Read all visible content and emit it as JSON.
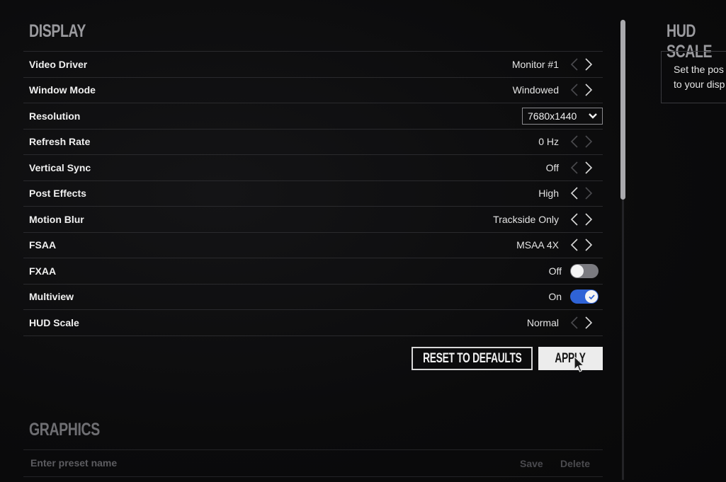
{
  "sections": {
    "display_title": "DISPLAY",
    "graphics_title": "GRAPHICS",
    "hud_title": "HUD SCALE"
  },
  "settings": [
    {
      "label": "Video Driver",
      "value": "Monitor #1",
      "control": "arrows",
      "left_enabled": false,
      "right_enabled": true
    },
    {
      "label": "Window Mode",
      "value": "Windowed",
      "control": "arrows",
      "left_enabled": false,
      "right_enabled": true
    },
    {
      "label": "Resolution",
      "value": "7680x1440",
      "control": "dropdown"
    },
    {
      "label": "Refresh Rate",
      "value": "0 Hz",
      "control": "arrows",
      "left_enabled": false,
      "right_enabled": false
    },
    {
      "label": "Vertical Sync",
      "value": "Off",
      "control": "arrows",
      "left_enabled": false,
      "right_enabled": true
    },
    {
      "label": "Post Effects",
      "value": "High",
      "control": "arrows",
      "left_enabled": true,
      "right_enabled": false
    },
    {
      "label": "Motion Blur",
      "value": "Trackside Only",
      "control": "arrows",
      "left_enabled": true,
      "right_enabled": true
    },
    {
      "label": "FSAA",
      "value": "MSAA 4X",
      "control": "arrows",
      "left_enabled": true,
      "right_enabled": true
    },
    {
      "label": "FXAA",
      "value": "Off",
      "control": "toggle",
      "state": false
    },
    {
      "label": "Multiview",
      "value": "On",
      "control": "toggle",
      "state": true
    },
    {
      "label": "HUD Scale",
      "value": "Normal",
      "control": "arrows",
      "left_enabled": false,
      "right_enabled": true
    }
  ],
  "buttons": {
    "reset": "RESET TO DEFAULTS",
    "apply": "APPLY"
  },
  "preset": {
    "placeholder": "Enter preset name",
    "value": "",
    "save": "Save",
    "delete": "Delete"
  },
  "hud_panel": {
    "line1": "Set the pos",
    "line2": "to your disp"
  },
  "colors": {
    "accent_blue": "#2f63d6",
    "background": "#0b0b0c",
    "divider": "#2a2a2d"
  },
  "scrollbar": {
    "thumb_fraction": 0.39
  }
}
